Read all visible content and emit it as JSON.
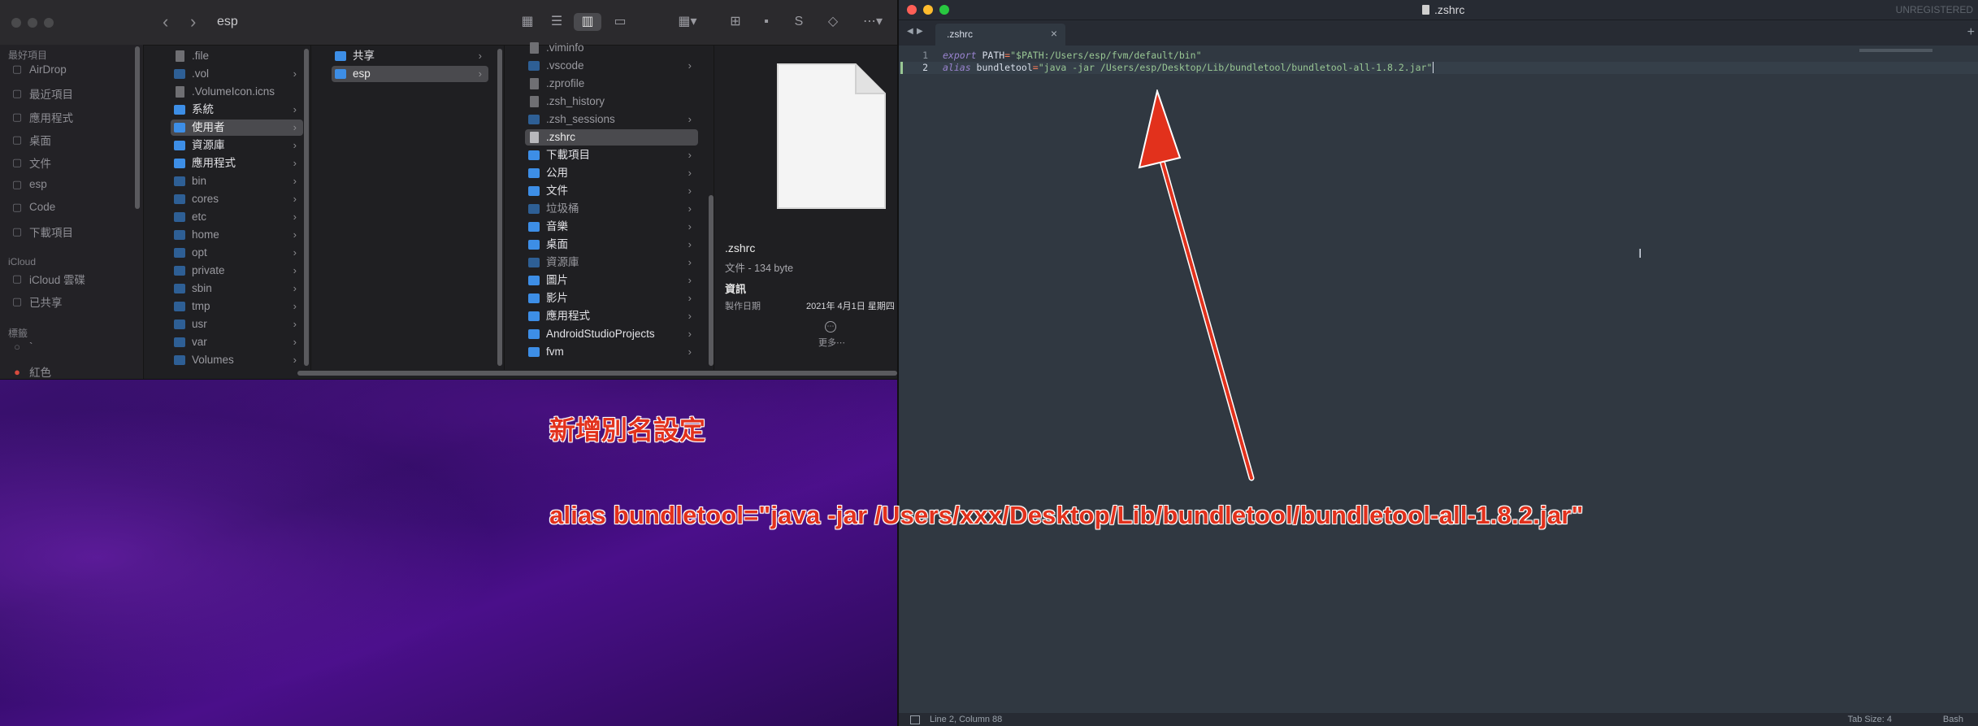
{
  "finder": {
    "title": "esp",
    "sidebar": {
      "favorites_header": "最好項目",
      "favorites": [
        {
          "label": "AirDrop",
          "icon": "airdrop-icon"
        },
        {
          "label": "最近項目",
          "icon": "clock-icon"
        },
        {
          "label": "應用程式",
          "icon": "apps-icon"
        },
        {
          "label": "桌面",
          "icon": "desktop-icon"
        },
        {
          "label": "文件",
          "icon": "document-icon"
        },
        {
          "label": "esp",
          "icon": "home-icon"
        },
        {
          "label": "Code",
          "icon": "folder-icon"
        },
        {
          "label": "下載項目",
          "icon": "download-icon"
        }
      ],
      "icloud_header": "iCloud",
      "icloud": [
        {
          "label": "iCloud 雲碟",
          "icon": "cloud-icon"
        },
        {
          "label": "已共享",
          "icon": "shared-folder-icon"
        }
      ],
      "tags_header": "標籤",
      "tags": [
        {
          "label": "`",
          "icon": "tag-circle-icon"
        },
        {
          "label": "紅色",
          "icon": "tag-red-icon"
        }
      ]
    },
    "column1": [
      {
        "label": ".file",
        "kind": "file"
      },
      {
        "label": ".vol",
        "kind": "folder-dim",
        "arrow": true
      },
      {
        "label": ".VolumeIcon.icns",
        "kind": "file"
      },
      {
        "label": "系統",
        "kind": "folder",
        "arrow": true,
        "bright": true
      },
      {
        "label": "使用者",
        "kind": "folder",
        "arrow": true,
        "selected": true
      },
      {
        "label": "資源庫",
        "kind": "folder",
        "arrow": true,
        "bright": true
      },
      {
        "label": "應用程式",
        "kind": "folder",
        "arrow": true,
        "bright": true
      },
      {
        "label": "bin",
        "kind": "folder-dim",
        "arrow": true
      },
      {
        "label": "cores",
        "kind": "folder-dim",
        "arrow": true
      },
      {
        "label": "etc",
        "kind": "folder-dim",
        "arrow": true
      },
      {
        "label": "home",
        "kind": "folder-dim",
        "arrow": true
      },
      {
        "label": "opt",
        "kind": "folder-dim",
        "arrow": true
      },
      {
        "label": "private",
        "kind": "folder-dim",
        "arrow": true
      },
      {
        "label": "sbin",
        "kind": "folder-dim",
        "arrow": true
      },
      {
        "label": "tmp",
        "kind": "folder-dim",
        "arrow": true
      },
      {
        "label": "usr",
        "kind": "folder-dim",
        "arrow": true
      },
      {
        "label": "var",
        "kind": "folder-dim",
        "arrow": true
      },
      {
        "label": "Volumes",
        "kind": "folder-dim",
        "arrow": true
      }
    ],
    "column2": [
      {
        "label": "共享",
        "kind": "folder",
        "arrow": true,
        "bright": true
      },
      {
        "label": "esp",
        "kind": "folder",
        "arrow": true,
        "selected": true
      }
    ],
    "column3": [
      {
        "label": ".viminfo",
        "kind": "file"
      },
      {
        "label": ".vscode",
        "kind": "folder-dim",
        "arrow": true
      },
      {
        "label": ".zprofile",
        "kind": "file"
      },
      {
        "label": ".zsh_history",
        "kind": "file"
      },
      {
        "label": ".zsh_sessions",
        "kind": "folder-dim",
        "arrow": true
      },
      {
        "label": ".zshrc",
        "kind": "file",
        "selected": true
      },
      {
        "label": "下載項目",
        "kind": "folder",
        "arrow": true,
        "bright": true
      },
      {
        "label": "公用",
        "kind": "folder",
        "arrow": true,
        "bright": true
      },
      {
        "label": "文件",
        "kind": "folder",
        "arrow": true,
        "bright": true
      },
      {
        "label": "垃圾桶",
        "kind": "folder-dim",
        "arrow": true
      },
      {
        "label": "音樂",
        "kind": "folder",
        "arrow": true,
        "bright": true
      },
      {
        "label": "桌面",
        "kind": "folder",
        "arrow": true,
        "bright": true
      },
      {
        "label": "資源庫",
        "kind": "folder-dim",
        "arrow": true
      },
      {
        "label": "圖片",
        "kind": "folder",
        "arrow": true,
        "bright": true
      },
      {
        "label": "影片",
        "kind": "folder",
        "arrow": true,
        "bright": true
      },
      {
        "label": "應用程式",
        "kind": "folder",
        "arrow": true,
        "bright": true
      },
      {
        "label": "AndroidStudioProjects",
        "kind": "folder",
        "arrow": true,
        "bright": true
      },
      {
        "label": "fvm",
        "kind": "folder",
        "arrow": true,
        "bright": true
      }
    ],
    "preview": {
      "filename": ".zshrc",
      "kind_size": "文件 - 134 byte",
      "info_header": "資訊",
      "created_label": "製作日期",
      "created_value": "2021年 4月1日 星期四",
      "more_label": "更多⋯"
    }
  },
  "editor": {
    "window_title": ".zshrc",
    "unregistered": "UNREGISTERED",
    "tab_label": ".zshrc",
    "lines": [
      {
        "num": "1",
        "tokens": [
          {
            "t": "export",
            "c": "kw"
          },
          {
            "t": " PATH",
            "c": "var"
          },
          {
            "t": "=",
            "c": "op"
          },
          {
            "t": "\"$PATH:/Users/esp/fvm/default/bin\"",
            "c": "str"
          }
        ]
      },
      {
        "num": "2",
        "current": true,
        "tokens": [
          {
            "t": "alias",
            "c": "kw"
          },
          {
            "t": " bundletool",
            "c": "var"
          },
          {
            "t": "=",
            "c": "op"
          },
          {
            "t": "\"java -jar /Users/esp/Desktop/Lib/bundletool/bundletool-all-1.8.2.jar\"",
            "c": "str"
          }
        ]
      }
    ],
    "status_left": "Line 2, Column 88",
    "status_tab": "Tab Size: 4",
    "status_syntax": "Bash"
  },
  "annotations": {
    "title": "新增別名設定",
    "alias_line": "alias bundletool=\"java -jar /Users/xxx/Desktop/Lib/bundletool/bundletool-all-1.8.2.jar\"",
    "arrow_color": "#e2311c"
  }
}
